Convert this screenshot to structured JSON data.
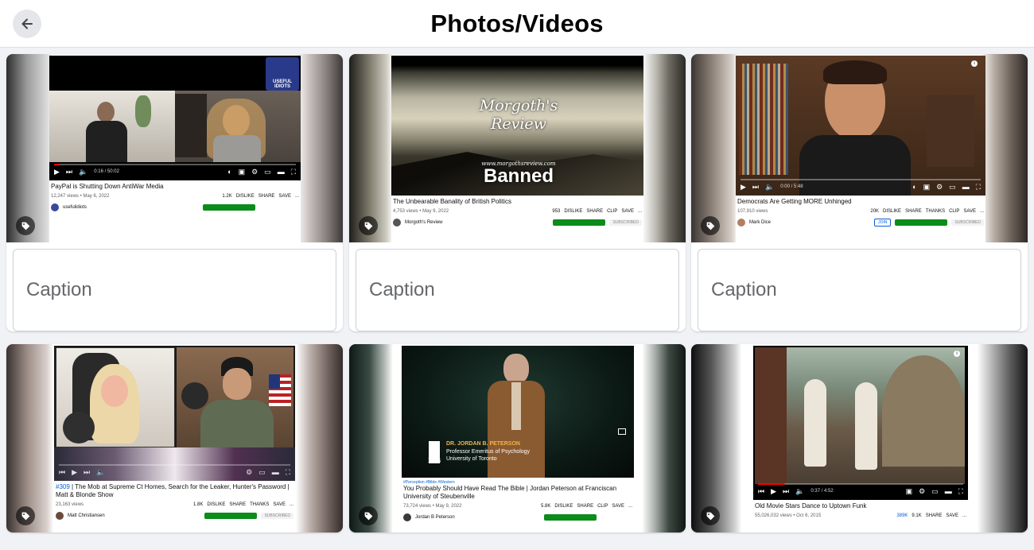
{
  "header": {
    "title": "Photos/Videos"
  },
  "caption_placeholder": "Caption",
  "cards": [
    {
      "title": "PayPal is Shutting Down AntiWar Media",
      "views": "12,247 views • May 6, 2022",
      "actions": [
        "1.2K",
        "DISLIKE",
        "SHARE",
        "SAVE",
        "..."
      ],
      "time": "0:16 / 50:02",
      "channel": "usefulidiots",
      "logo": "USEFUL IDIOTS"
    },
    {
      "title": "The Unbearable Banality of British Politics",
      "views": "4,753 views • May 9, 2022",
      "actions": [
        "953",
        "DISLIKE",
        "SHARE",
        "CLIP",
        "SAVE",
        "..."
      ],
      "overlay_title": "Morgoth's Review",
      "overlay_url": "www.morgothsreview.com",
      "banned": "Banned",
      "channel": "Morgoth's Review",
      "subscribed": "SUBSCRIBED"
    },
    {
      "title": "Democrats Are Getting MORE Unhinged",
      "views": "107,910 views",
      "actions": [
        "20K",
        "DISLIKE",
        "SHARE",
        "THANKS",
        "CLIP",
        "SAVE",
        "..."
      ],
      "time": "0:00 / 5:48",
      "channel": "Mark Dice",
      "join": "JOIN",
      "subscribed": "SUBSCRIBED"
    },
    {
      "hashtag": "#309",
      "title": " | The Mob at Supreme Ct Homes, Search for the Leaker, Hunter's Password | Matt & Blonde Show",
      "views": "23,163 views",
      "actions": [
        "1.8K",
        "DISLIKE",
        "SHARE",
        "THANKS",
        "SAVE",
        "..."
      ],
      "channel": "Matt Christiansen",
      "subscribed": "SUBSCRIBED"
    },
    {
      "hashtags": "#Perception #Bible #Western",
      "title": "You Probably Should Have Read The Bible | Jordan Peterson at Franciscan University of Steubenville",
      "views": "73,724 views • May 9, 2022",
      "actions": [
        "5.8K",
        "DISLIKE",
        "SHARE",
        "CLIP",
        "SAVE",
        "..."
      ],
      "lower_third_name": "DR. JORDAN B. PETERSON",
      "lower_third_role1": "Professor Emeritus of Psychology",
      "lower_third_role2": "University of Toronto",
      "lower_third_logo": "FUS",
      "channel": "Jordan B Peterson"
    },
    {
      "title": "Old Movie Stars Dance to Uptown Funk",
      "views": "55,026,032 views • Oct 6, 2015",
      "actions": [
        "389K",
        "9.1K",
        "SHARE",
        "SAVE",
        "..."
      ],
      "time": "0:37 / 4:52"
    }
  ]
}
